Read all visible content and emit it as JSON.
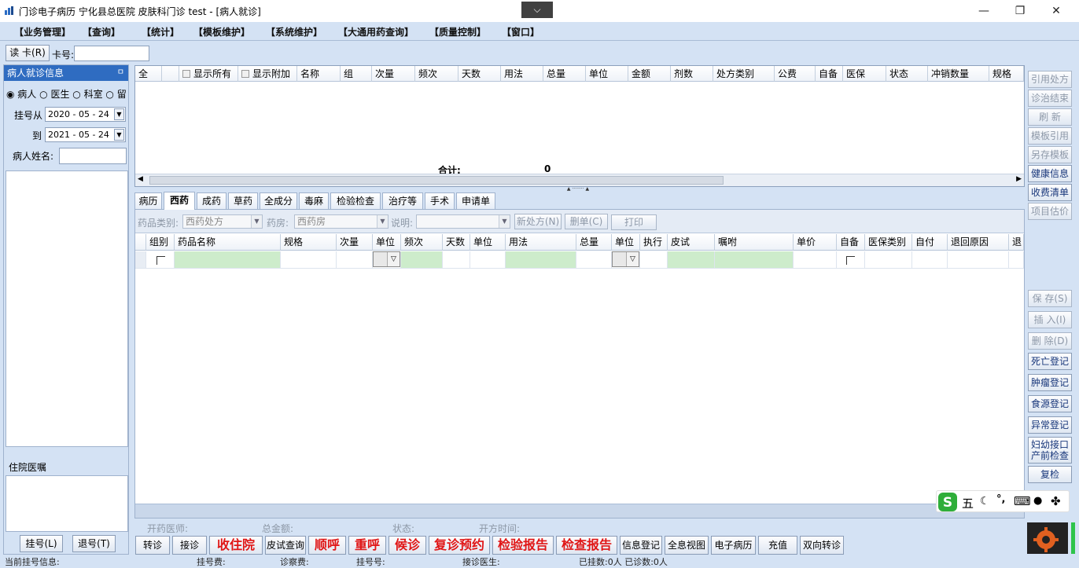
{
  "window": {
    "title": "门诊电子病历  宁化县总医院  皮肤科门诊  test - [病人就诊]",
    "dropdown_glyph": "⌵",
    "minimize": "—",
    "restore": "❐",
    "close": "✕"
  },
  "menu": [
    "【业务管理】",
    "【查询】",
    "【统计】",
    "【模板维护】",
    "【系统维护】",
    "【大通用药查询】",
    "【质量控制】",
    "【窗口】"
  ],
  "toolbar": {
    "read_card": "读 卡(R)",
    "card_label": "卡号:",
    "card_value": ""
  },
  "left": {
    "header": "病人就诊信息",
    "pin": "ㅁ",
    "radios": [
      {
        "label": "病人",
        "checked": true
      },
      {
        "label": "医生",
        "checked": false
      },
      {
        "label": "科室",
        "checked": false
      },
      {
        "label": "留",
        "checked": false
      }
    ],
    "reg_from_label": "挂号从",
    "reg_from": "2020 - 05 - 24",
    "reg_to_label": "到",
    "reg_to": "2021 - 05 - 24",
    "name_label": "病人姓名:",
    "inpatient_header": "住院医嘱",
    "register_btn": "挂号(L)",
    "unregister_btn": "退号(T)"
  },
  "grid1": {
    "columns": [
      "全",
      "",
      "显示所有",
      "显示附加",
      "名称",
      "组",
      "次量",
      "频次",
      "天数",
      "用法",
      "总量",
      "单位",
      "金额",
      "剂数",
      "处方类别",
      "公费",
      "自备",
      "医保",
      "状态",
      "冲销数量",
      "规格"
    ],
    "total_label": "合计:",
    "total_value": "0"
  },
  "tabs": [
    "病历",
    "西药",
    "成药",
    "草药",
    "全成分",
    "毒麻",
    "检验检查",
    "治疗等",
    "手术",
    "申请单"
  ],
  "active_tab": "西药",
  "rx": {
    "type_label": "药品类别:",
    "type_value": "西药处方",
    "pharmacy_label": "药房:",
    "pharmacy_value": "西药房",
    "note_label": "说明:",
    "note_value": "",
    "new_btn": "新处方(N)",
    "delete_btn": "删单(C)",
    "print_btn": "打印"
  },
  "grid2": {
    "columns": [
      "组别",
      "药品名称",
      "规格",
      "次量",
      "单位",
      "频次",
      "天数",
      "单位",
      "用法",
      "总量",
      "单位",
      "执行",
      "皮试",
      "嘱咐",
      "单价",
      "自备",
      "医保类别",
      "自付",
      "退回原因",
      "退"
    ]
  },
  "status": {
    "doctor": "开药医师:",
    "total": "总金额:",
    "state": "状态:",
    "time": "开方时间:"
  },
  "bottom_buttons": [
    {
      "label": "转诊",
      "style": "normal"
    },
    {
      "label": "接诊",
      "style": "normal"
    },
    {
      "label": "收住院",
      "style": "red"
    },
    {
      "label": "皮试查询",
      "style": "normal"
    },
    {
      "label": "顺呼",
      "style": "red"
    },
    {
      "label": "重呼",
      "style": "red"
    },
    {
      "label": "候诊",
      "style": "red"
    },
    {
      "label": "复诊预约",
      "style": "red"
    },
    {
      "label": "检验报告",
      "style": "red"
    },
    {
      "label": "检查报告",
      "style": "red"
    },
    {
      "label": "信息登记",
      "style": "normal"
    },
    {
      "label": "全息视图",
      "style": "normal"
    },
    {
      "label": "电子病历",
      "style": "normal"
    },
    {
      "label": "充值",
      "style": "normal"
    },
    {
      "label": "双向转诊",
      "style": "normal"
    }
  ],
  "bottom_status": {
    "current": "当前挂号信息:",
    "reg_fee": "挂号费:",
    "consult_fee": "诊察费:",
    "reg_no": "挂号号:",
    "doctor": "接诊医生:",
    "counts": "已挂数:0人  已诊数:0人"
  },
  "right_buttons": [
    {
      "label": "引用处方",
      "enabled": false
    },
    {
      "label": "诊治结束",
      "enabled": false
    },
    {
      "label": "刷  新",
      "enabled": false
    },
    {
      "label": "模板引用",
      "enabled": false
    },
    {
      "label": "另存模板",
      "enabled": false
    },
    {
      "label": "健康信息",
      "enabled": true
    },
    {
      "label": "收费清单",
      "enabled": true
    },
    {
      "label": "项目估价",
      "enabled": false
    }
  ],
  "right_buttons2": [
    {
      "label": "保  存(S)",
      "enabled": false
    },
    {
      "label": "插  入(I)",
      "enabled": false
    },
    {
      "label": "删  除(D)",
      "enabled": false
    },
    {
      "label": "死亡登记",
      "enabled": true
    },
    {
      "label": "肿瘤登记",
      "enabled": true
    },
    {
      "label": "食源登记",
      "enabled": true
    },
    {
      "label": "异常登记",
      "enabled": true
    },
    {
      "label": "妇幼接口产前检查",
      "enabled": true
    },
    {
      "label": "复检",
      "enabled": true
    }
  ],
  "ime": {
    "mode": "五",
    "moon": "☾",
    "punct": "°,",
    "keyboard": "⌨",
    "user": "●",
    "grid": "✤"
  }
}
